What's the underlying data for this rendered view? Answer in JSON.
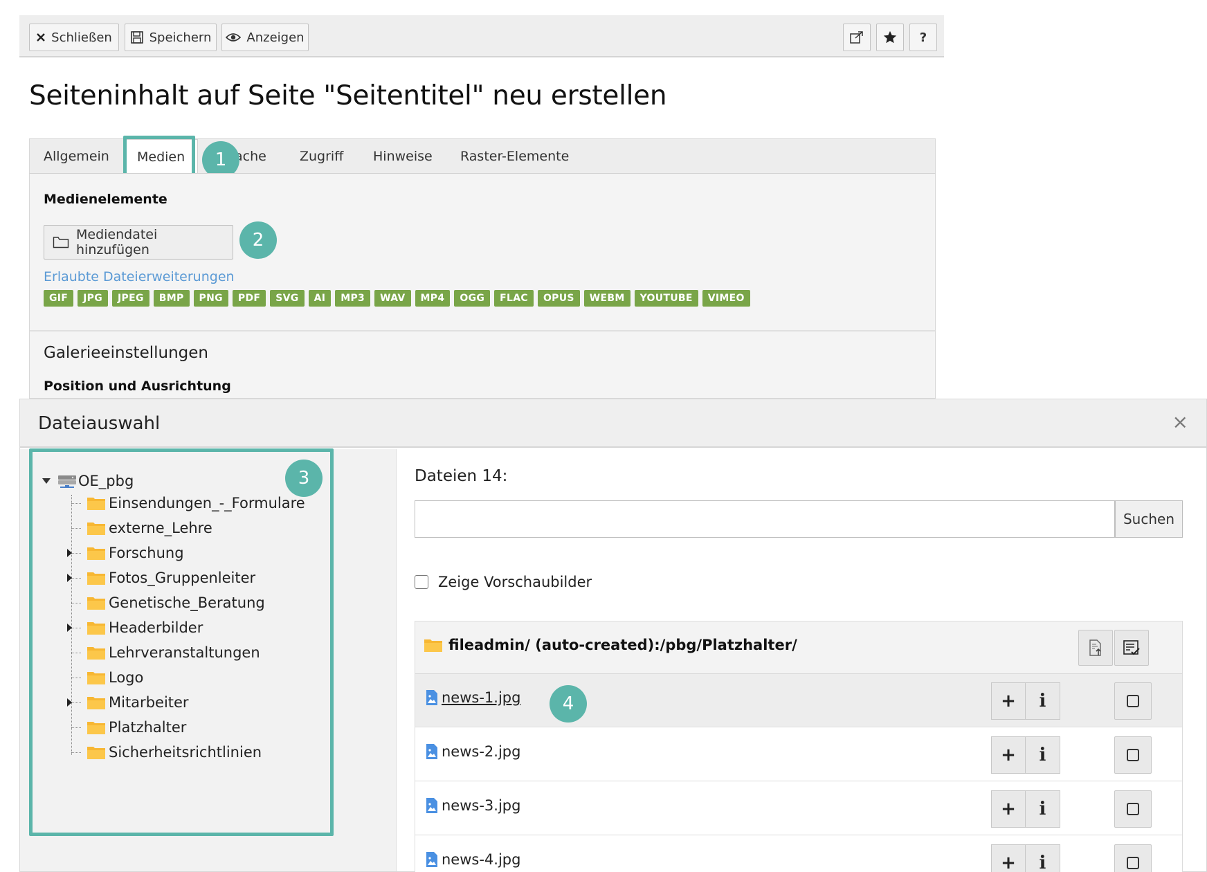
{
  "toolbar": {
    "close_label": "Schließen",
    "save_label": "Speichern",
    "view_label": "Anzeigen",
    "icons": [
      "external-link-icon",
      "star-icon",
      "help-icon"
    ],
    "help_glyph": "?"
  },
  "page_title": "Seiteninhalt auf Seite \"Seitentitel\" neu erstellen",
  "tabs": [
    {
      "label": "Allgemein"
    },
    {
      "label": "Medien",
      "active": true
    },
    {
      "label": "ache"
    },
    {
      "label": "Zugriff"
    },
    {
      "label": "Hinweise"
    },
    {
      "label": "Raster-Elemente"
    }
  ],
  "media": {
    "section_label": "Medienelemente",
    "add_button_label": "Mediendatei hinzufügen",
    "allowed_link": "Erlaubte Dateierweiterungen",
    "extensions": [
      "GIF",
      "JPG",
      "JPEG",
      "BMP",
      "PNG",
      "PDF",
      "SVG",
      "AI",
      "MP3",
      "WAV",
      "MP4",
      "OGG",
      "FLAC",
      "OPUS",
      "WEBM",
      "YOUTUBE",
      "VIMEO"
    ],
    "badge_color": "#79a548"
  },
  "gallery": {
    "title": "Galerieeinstellungen",
    "subtitle": "Position und Ausrichtung"
  },
  "callouts": [
    "1",
    "2",
    "3",
    "4"
  ],
  "accent_color": "#5bb5aa",
  "modal": {
    "title": "Dateiauswahl",
    "close_glyph": "×",
    "tree": {
      "root": "OE_pbg",
      "items": [
        {
          "label": "Einsendungen_-_Formulare",
          "expandable": false
        },
        {
          "label": "externe_Lehre",
          "expandable": false
        },
        {
          "label": "Forschung",
          "expandable": true
        },
        {
          "label": "Fotos_Gruppenleiter",
          "expandable": true
        },
        {
          "label": "Genetische_Beratung",
          "expandable": false
        },
        {
          "label": "Headerbilder",
          "expandable": true
        },
        {
          "label": "Lehrveranstaltungen",
          "expandable": false
        },
        {
          "label": "Logo",
          "expandable": false
        },
        {
          "label": "Mitarbeiter",
          "expandable": true
        },
        {
          "label": "Platzhalter",
          "expandable": false
        },
        {
          "label": "Sicherheitsrichtlinien",
          "expandable": false
        }
      ]
    },
    "files": {
      "count_label": "Dateien 14:",
      "search_value": "",
      "search_button": "Suchen",
      "thumbnail_toggle_label": "Zeige Vorschaubilder",
      "folder_path": "fileadmin/ (auto-created):/pbg/Platzhalter/",
      "rows": [
        {
          "name": "news-1.jpg"
        },
        {
          "name": "news-2.jpg"
        },
        {
          "name": "news-3.jpg"
        },
        {
          "name": "news-4.jpg"
        }
      ],
      "add_glyph": "+",
      "info_glyph": "i"
    }
  }
}
